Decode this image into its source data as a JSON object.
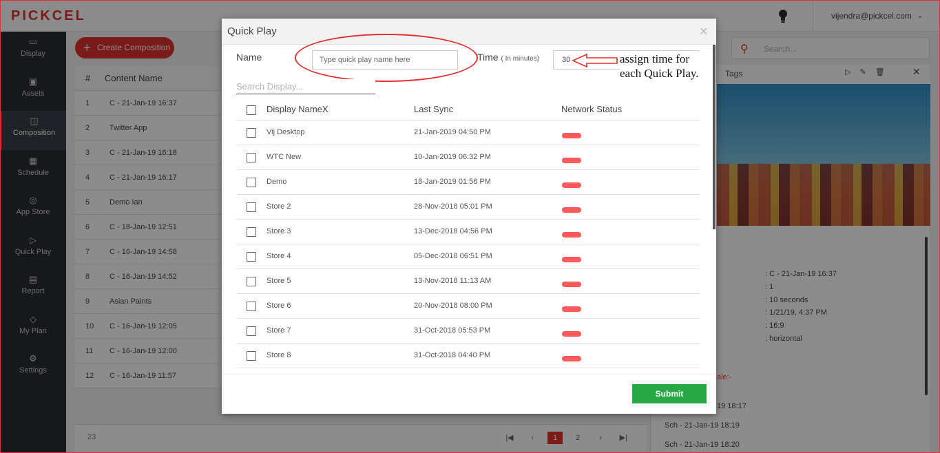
{
  "brand": {
    "logo_text": "PICKCEL",
    "accent_color": "#e0322f"
  },
  "header": {
    "user_email": "vijendra@pickcel.com"
  },
  "sidebar": {
    "items": [
      {
        "label": "Display",
        "icon": "monitor-icon",
        "glyph": "▭"
      },
      {
        "label": "Assets",
        "icon": "image-icon",
        "glyph": "▣"
      },
      {
        "label": "Composition",
        "icon": "layout-icon",
        "glyph": "◫",
        "active": true
      },
      {
        "label": "Schedule",
        "icon": "calendar-icon",
        "glyph": "▦"
      },
      {
        "label": "App Store",
        "icon": "compass-icon",
        "glyph": "◎"
      },
      {
        "label": "Quick Play",
        "icon": "play-icon",
        "glyph": "▷"
      },
      {
        "label": "Report",
        "icon": "report-icon",
        "glyph": "▤"
      },
      {
        "label": "My Plan",
        "icon": "diamond-icon",
        "glyph": "◇"
      },
      {
        "label": "Settings",
        "icon": "gear-icon",
        "glyph": "⚙"
      }
    ]
  },
  "main": {
    "create_label": "Create Composition",
    "table_headers": {
      "num": "#",
      "name": "Content Name"
    },
    "rows": [
      {
        "n": "1",
        "name": "C - 21-Jan-19 16:37"
      },
      {
        "n": "2",
        "name": "Twitter App"
      },
      {
        "n": "3",
        "name": "C - 21-Jan-19 16:18"
      },
      {
        "n": "4",
        "name": "C - 21-Jan-19 16:17"
      },
      {
        "n": "5",
        "name": "Demo Ian"
      },
      {
        "n": "6",
        "name": "C - 18-Jan-19 12:51"
      },
      {
        "n": "7",
        "name": "C - 16-Jan-19 14:58"
      },
      {
        "n": "8",
        "name": "C - 16-Jan-19 14:52"
      },
      {
        "n": "9",
        "name": "Asian Paints"
      },
      {
        "n": "10",
        "name": "C - 16-Jan-19 12:05"
      },
      {
        "n": "11",
        "name": "C - 16-Jan-19 12:00"
      },
      {
        "n": "12",
        "name": "C - 16-Jan-19 11:57"
      }
    ],
    "total_count": "23",
    "pagination": {
      "first": "|◀",
      "prev": "‹",
      "page1": "1",
      "page2": "2",
      "next": "›",
      "last": "▶|"
    }
  },
  "search": {
    "placeholder": "Search..."
  },
  "details": {
    "tags_label": "Tags",
    "meta_values": [
      ": C - 21-Jan-19 16:37",
      ": 1",
      ": 10 seconds",
      ": 1/21/19, 4:37 PM",
      ": 16:9",
      ": horizontal"
    ],
    "schedule_header": "ale:-",
    "schedule_partial": "19 18:17",
    "schedules": [
      "Sch - 21-Jan-19 18:19",
      "Sch - 21-Jan-19 18:20"
    ]
  },
  "modal": {
    "title": "Quick Play",
    "close_glyph": "×",
    "name_label": "Name",
    "name_placeholder": "Type quick play name here",
    "time_label": "Time",
    "time_sub": "( In minutes)",
    "time_value": "30",
    "annotation_line1": "assign time for",
    "annotation_line2": "each Quick Play.",
    "search_placeholder": "Search Display...",
    "columns": {
      "name": "Display NameX",
      "sync": "Last Sync",
      "status": "Network Status"
    },
    "displays": [
      {
        "name": "Vij Desktop",
        "sync": "21-Jan-2019 04:50 PM",
        "status": "offline"
      },
      {
        "name": "WTC New",
        "sync": "10-Jan-2019 06:32 PM",
        "status": "offline"
      },
      {
        "name": "Demo",
        "sync": "18-Jan-2019 01:56 PM",
        "status": "offline"
      },
      {
        "name": "Store 2",
        "sync": "28-Nov-2018 05:01 PM",
        "status": "offline"
      },
      {
        "name": "Store 3",
        "sync": "13-Dec-2018 04:56 PM",
        "status": "offline"
      },
      {
        "name": "Store 4",
        "sync": "05-Dec-2018 06:51 PM",
        "status": "offline"
      },
      {
        "name": "Store 5",
        "sync": "13-Nov-2018 11:13 AM",
        "status": "offline"
      },
      {
        "name": "Store 6",
        "sync": "20-Nov-2018 08:00 PM",
        "status": "offline"
      },
      {
        "name": "Store 7",
        "sync": "31-Oct-2018 05:53 PM",
        "status": "offline"
      },
      {
        "name": "Store 8",
        "sync": "31-Oct-2018 04:40 PM",
        "status": "offline"
      }
    ],
    "submit_label": "Submit",
    "status_color_offline": "#ff5b5b",
    "submit_color": "#28a745"
  }
}
